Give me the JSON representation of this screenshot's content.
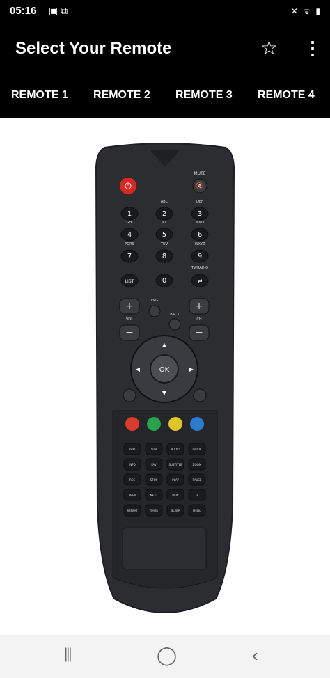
{
  "status_bar": {
    "time": "05:16",
    "left_icons": [
      "message-icon",
      "screen-cast-icon"
    ],
    "right_icons_text": "✕  ᯤ  ▮"
  },
  "app_bar": {
    "title": "Select Your Remote",
    "icons": [
      "star-icon",
      "more-vert-icon"
    ]
  },
  "tabs": [
    {
      "label": "REMOTE 1"
    },
    {
      "label": "REMOTE 2"
    },
    {
      "label": "REMOTE 3"
    },
    {
      "label": "REMOTE 4"
    }
  ],
  "remote": {
    "labels": {
      "mute": "MUTE",
      "abc": "ABC",
      "def": "DEF",
      "ghi": "GHI",
      "jkl": "JKL",
      "mno": "MNO",
      "pqrs": "PQRS",
      "tuv": "TUV",
      "wxyz": "WXYZ",
      "tv_radio": "TV/RADIO",
      "list": "LIST",
      "epg": "EPG",
      "back": "BACK",
      "vol": "VOL",
      "ch": "CH",
      "ok": "OK"
    },
    "digits": [
      "1",
      "2",
      "3",
      "4",
      "5",
      "6",
      "7",
      "8",
      "9",
      "0"
    ],
    "color_buttons": [
      "#d93b2f",
      "#27a34a",
      "#e0c52b",
      "#2b7bd1"
    ],
    "bottom_grid_rows": [
      [
        "TEXT",
        "SUB",
        "AUDIO",
        "GUIDE"
      ],
      [
        "INFO",
        "FAV",
        "SUBTITLE",
        "ZOOM"
      ],
      [
        "REC",
        "STOP",
        "PLAY",
        "PAUSE"
      ],
      [
        "PREV",
        "NEXT",
        "REW",
        "FF"
      ],
      [
        "REPEAT",
        "TIMER",
        "SLEEP",
        "MENU"
      ]
    ]
  },
  "nav_bar": {
    "icons": [
      "recent-apps-icon",
      "home-icon",
      "back-icon"
    ]
  }
}
